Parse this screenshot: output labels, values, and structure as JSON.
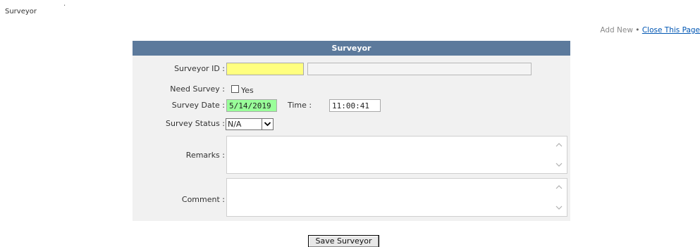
{
  "page": {
    "title": "Surveyor",
    "dot": "."
  },
  "top_links": {
    "add_new": "Add New",
    "separator": "•",
    "close": "Close This Page"
  },
  "form": {
    "header": "Surveyor",
    "surveyor_id": {
      "label": "Surveyor ID :",
      "value": "",
      "name_value": ""
    },
    "need_survey": {
      "label": "Need Survey :",
      "checkbox_label": "Yes",
      "checked": false
    },
    "survey_date": {
      "label": "Survey Date :",
      "value": "5/14/2019"
    },
    "time": {
      "label": "Time :",
      "value": "11:00:41"
    },
    "survey_status": {
      "label": "Survey Status :",
      "selected": "N/A"
    },
    "remarks": {
      "label": "Remarks :",
      "value": ""
    },
    "comment": {
      "label": "Comment :",
      "value": ""
    }
  },
  "save_button": "Save Surveyor",
  "colors": {
    "header_bg": "#5c7a9c",
    "surveyor_id_bg": "#ffff7f",
    "survey_date_bg": "#99ff99",
    "link": "#0056b3"
  }
}
